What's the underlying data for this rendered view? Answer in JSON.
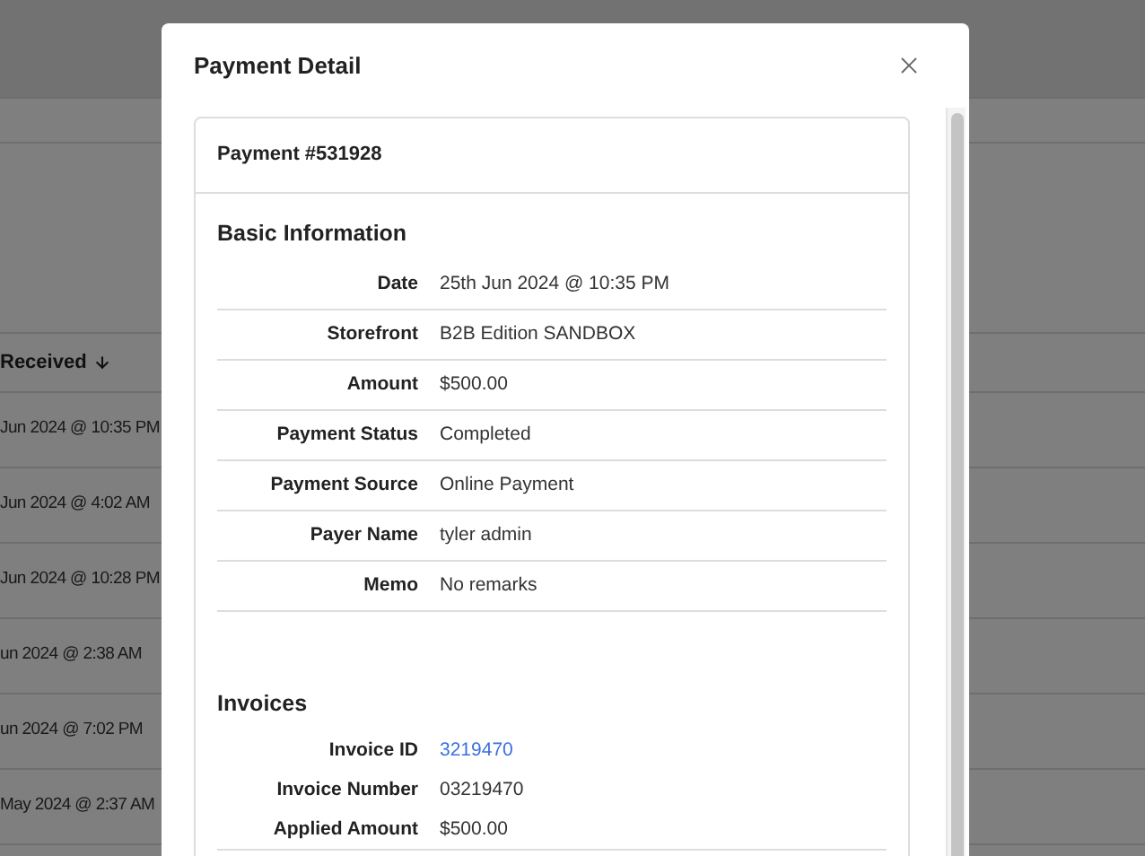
{
  "background_table": {
    "column_header": "Received",
    "cells": [
      "Jun 2024 @ 10:35 PM",
      "Jun 2024 @ 4:02 AM",
      "Jun 2024 @ 10:28 PM",
      "un 2024 @ 2:38 AM",
      "un 2024 @ 7:02 PM",
      "May 2024 @ 2:37 AM"
    ]
  },
  "dialog": {
    "title": "Payment Detail",
    "card_title": "Payment #531928",
    "sections": [
      {
        "heading": "Basic Information",
        "divided": true,
        "rows": [
          {
            "label": "Date",
            "value": "25th Jun 2024 @ 10:35 PM",
            "kind": "text"
          },
          {
            "label": "Storefront",
            "value": "B2B Edition SANDBOX",
            "kind": "text"
          },
          {
            "label": "Amount",
            "value": "$500.00",
            "kind": "text"
          },
          {
            "label": "Payment Status",
            "value": "Completed",
            "kind": "text"
          },
          {
            "label": "Payment Source",
            "value": "Online Payment",
            "kind": "text"
          },
          {
            "label": "Payer Name",
            "value": "tyler admin",
            "kind": "text"
          },
          {
            "label": "Memo",
            "value": "No remarks",
            "kind": "text"
          }
        ]
      },
      {
        "heading": "Invoices",
        "divided": false,
        "rows": [
          {
            "label": "Invoice ID",
            "value": "3219470",
            "kind": "link"
          },
          {
            "label": "Invoice Number",
            "value": "03219470",
            "kind": "text"
          },
          {
            "label": "Applied Amount",
            "value": "$500.00",
            "kind": "text"
          }
        ]
      }
    ]
  }
}
